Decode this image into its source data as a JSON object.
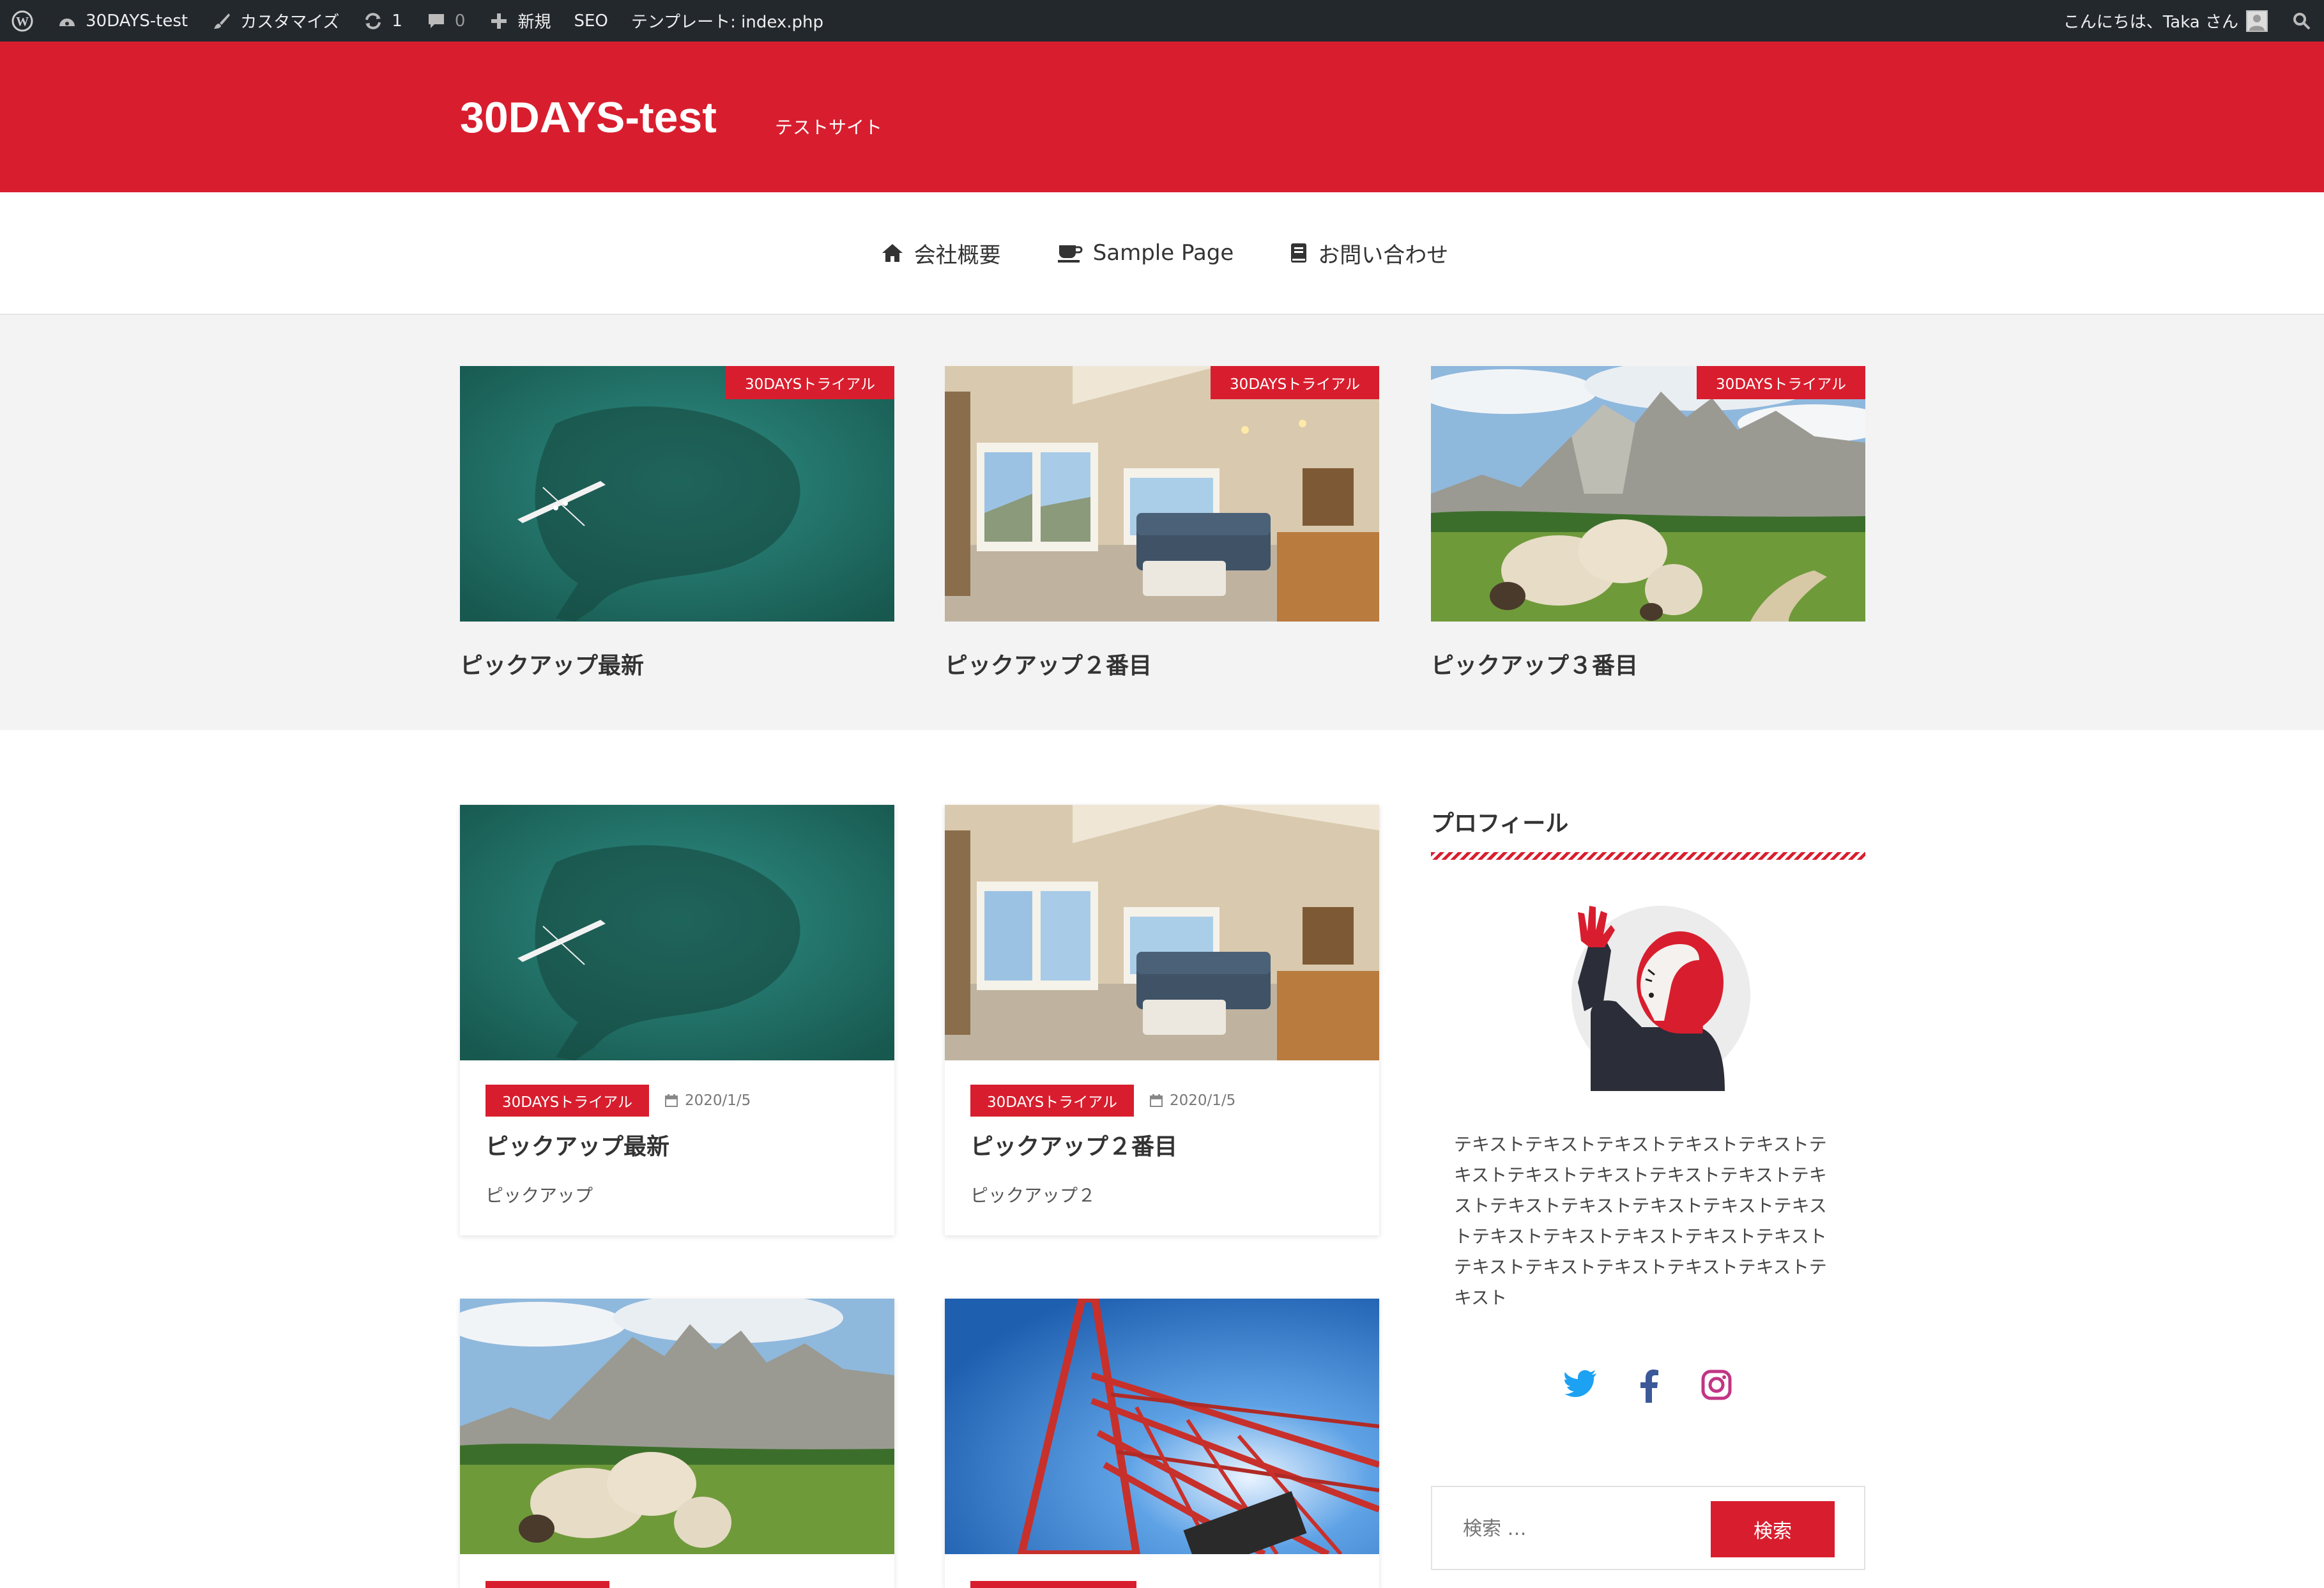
{
  "admin_bar": {
    "site_name": "30DAYS-test",
    "customize": "カスタマイズ",
    "updates_count": "1",
    "comments_count": "0",
    "new_label": "新規",
    "seo_label": "SEO",
    "template_label": "テンプレート: index.php",
    "greeting": "こんにちは、Taka さん"
  },
  "header": {
    "site_title": "30DAYS-test",
    "tagline": "テストサイト"
  },
  "nav": {
    "items": [
      {
        "label": "会社概要",
        "icon": "home-icon"
      },
      {
        "label": "Sample Page",
        "icon": "coffee-icon"
      },
      {
        "label": "お問い合わせ",
        "icon": "book-icon"
      }
    ]
  },
  "pickup": [
    {
      "category": "30DAYSトライアル",
      "title": "ピックアップ最新",
      "image": "whale-kayak-image"
    },
    {
      "category": "30DAYSトライアル",
      "title": "ピックアップ２番目",
      "image": "living-room-image"
    },
    {
      "category": "30DAYSトライアル",
      "title": "ピックアップ３番目",
      "image": "sheep-mountains-image"
    }
  ],
  "posts": [
    {
      "category": "30DAYSトライアル",
      "date": "2020/1/5",
      "title": "ピックアップ最新",
      "excerpt": "ピックアップ"
    },
    {
      "category": "30DAYSトライアル",
      "date": "2020/1/5",
      "title": "ピックアップ２番目",
      "excerpt": "ピックアップ２"
    }
  ],
  "sidebar": {
    "profile_title": "プロフィール",
    "profile_text": "テキストテキストテキストテキストテキストテキストテキストテキストテキストテキストテキストテキストテキストテキストテキストテキストテキストテキストテキストテキストテキストテキストテキストテキストテキストテキストテキスト",
    "social": [
      "twitter-icon",
      "facebook-icon",
      "instagram-icon"
    ],
    "search_placeholder": "検索 …",
    "search_button": "検索"
  },
  "colors": {
    "brand_red": "#d81e2e",
    "admin_bar": "#23282d",
    "twitter": "#1da1f2",
    "facebook": "#3b5998",
    "instagram": "#c13584"
  }
}
